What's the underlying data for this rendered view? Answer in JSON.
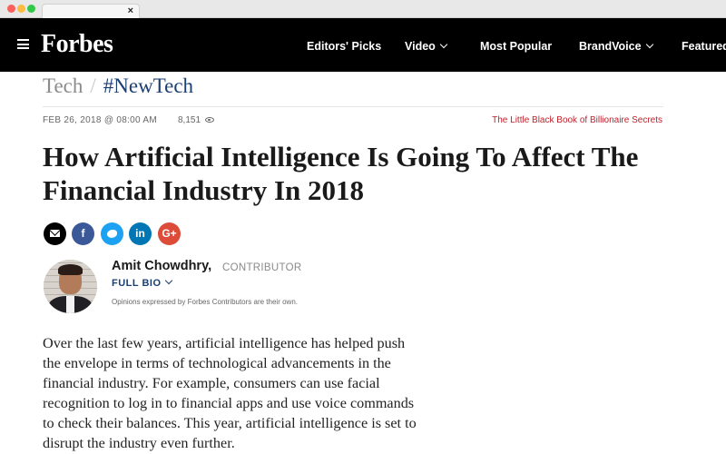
{
  "browser": {
    "tab_close": "×"
  },
  "nav": {
    "logo": "Forbes",
    "items": [
      {
        "label": "Editors' Picks",
        "has_dropdown": false
      },
      {
        "label": "Video",
        "has_dropdown": true
      },
      {
        "label": "Most Popular",
        "has_dropdown": false
      },
      {
        "label": "BrandVoice",
        "has_dropdown": true
      },
      {
        "label": "Featured",
        "has_dropdown": false
      }
    ]
  },
  "breadcrumb": {
    "section": "Tech",
    "separator": "/",
    "tag": "#NewTech"
  },
  "meta": {
    "date": "FEB 26, 2018 @ 08:00 AM",
    "views": "8,151"
  },
  "promo": "The Little Black Book of Billionaire Secrets",
  "headline": "How Artificial Intelligence Is Going To Affect The Financial Industry In 2018",
  "share": {
    "facebook": "f",
    "linkedin": "in",
    "google": "G+"
  },
  "author": {
    "name": "Amit Chowdhry",
    "name_suffix": ",",
    "role": "CONTRIBUTOR",
    "full_bio": "FULL BIO",
    "disclaimer": "Opinions expressed by Forbes Contributors are their own."
  },
  "body": "Over the last few years, artificial intelligence has helped push the envelope in terms of technological advancements in the financial industry. For example, consumers can use facial recognition to log in to financial apps and use voice commands to check their balances. This year, artificial intelligence is set to disrupt the industry even further.",
  "colors": {
    "nav_bg": "#000000",
    "tag_blue": "#1c3f72",
    "promo_red": "#c0202a"
  }
}
